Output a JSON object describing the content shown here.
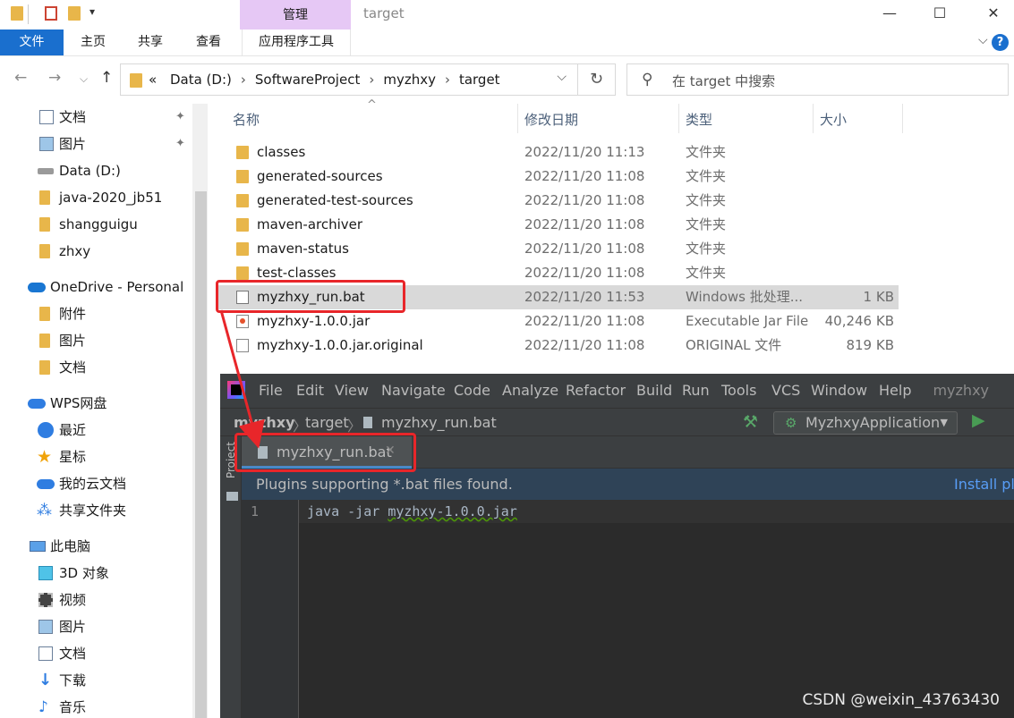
{
  "titlebar": {
    "manage_tab": "管理",
    "window_title": "target",
    "minimize": "—",
    "maximize": "☐",
    "close": "✕"
  },
  "ribbon": {
    "tabs": [
      "文件",
      "主页",
      "共享",
      "查看",
      "应用程序工具"
    ],
    "expand": "⌵",
    "help": "?"
  },
  "nav": {
    "back": "←",
    "forward": "→",
    "recent": "⌵",
    "up": "↑",
    "crumb_lead": "«",
    "crumbs": [
      "Data (D:)",
      "SoftwareProject",
      "myzhxy",
      "target"
    ],
    "search_placeholder": "在 target 中搜索"
  },
  "sidebar": {
    "items": [
      {
        "label": "文档",
        "icon": "document-icon",
        "pinned": true
      },
      {
        "label": "图片",
        "icon": "picture-icon",
        "pinned": true
      },
      {
        "label": "Data (D:)",
        "icon": "drive-icon"
      },
      {
        "label": "java-2020_jb51",
        "icon": "folder-icon"
      },
      {
        "label": "shangguigu",
        "icon": "folder-icon"
      },
      {
        "label": "zhxy",
        "icon": "folder-icon"
      },
      {
        "label": "OneDrive - Personal",
        "icon": "cloud-icon"
      },
      {
        "label": "附件",
        "icon": "folder-icon"
      },
      {
        "label": "图片",
        "icon": "folder-icon"
      },
      {
        "label": "文档",
        "icon": "folder-icon"
      },
      {
        "label": "WPS网盘",
        "icon": "cloud-icon"
      },
      {
        "label": "最近",
        "icon": "clock-icon"
      },
      {
        "label": "星标",
        "icon": "star-icon"
      },
      {
        "label": "我的云文档",
        "icon": "cloud-icon"
      },
      {
        "label": "共享文件夹",
        "icon": "share-icon"
      },
      {
        "label": "此电脑",
        "icon": "computer-icon"
      },
      {
        "label": "3D 对象",
        "icon": "cube-icon"
      },
      {
        "label": "视频",
        "icon": "video-icon"
      },
      {
        "label": "图片",
        "icon": "picture-icon"
      },
      {
        "label": "文档",
        "icon": "document-icon"
      },
      {
        "label": "下载",
        "icon": "download-icon"
      },
      {
        "label": "音乐",
        "icon": "music-icon"
      }
    ],
    "pin_glyph": "📌"
  },
  "filelist": {
    "columns": [
      "名称",
      "修改日期",
      "类型",
      "大小"
    ],
    "sort_caret": "^",
    "rows": [
      {
        "name": "classes",
        "date": "2022/11/20 11:13",
        "type": "文件夹",
        "size": "",
        "kind": "folder"
      },
      {
        "name": "generated-sources",
        "date": "2022/11/20 11:08",
        "type": "文件夹",
        "size": "",
        "kind": "folder"
      },
      {
        "name": "generated-test-sources",
        "date": "2022/11/20 11:08",
        "type": "文件夹",
        "size": "",
        "kind": "folder"
      },
      {
        "name": "maven-archiver",
        "date": "2022/11/20 11:08",
        "type": "文件夹",
        "size": "",
        "kind": "folder"
      },
      {
        "name": "maven-status",
        "date": "2022/11/20 11:08",
        "type": "文件夹",
        "size": "",
        "kind": "folder"
      },
      {
        "name": "test-classes",
        "date": "2022/11/20 11:08",
        "type": "文件夹",
        "size": "",
        "kind": "folder"
      },
      {
        "name": "myzhxy_run.bat",
        "date": "2022/11/20 11:53",
        "type": "Windows 批处理...",
        "size": "1 KB",
        "kind": "bat",
        "selected": true
      },
      {
        "name": "myzhxy-1.0.0.jar",
        "date": "2022/11/20 11:08",
        "type": "Executable Jar File",
        "size": "40,246 KB",
        "kind": "jar"
      },
      {
        "name": "myzhxy-1.0.0.jar.original",
        "date": "2022/11/20 11:08",
        "type": "ORIGINAL 文件",
        "size": "819 KB",
        "kind": "file"
      }
    ]
  },
  "ide": {
    "menu": [
      "File",
      "Edit",
      "View",
      "Navigate",
      "Code",
      "Analyze",
      "Refactor",
      "Build",
      "Run",
      "Tools",
      "VCS",
      "Window",
      "Help"
    ],
    "project_name": "myzhxy",
    "nav_crumbs": [
      "myzhxy",
      "target",
      "myzhxy_run.bat"
    ],
    "run_config": "MyzhxyApplication",
    "side_tab": "Project",
    "tab_label": "myzhxy_run.bat",
    "tab_close": "✕",
    "banner_message": "Plugins supporting *.bat files found.",
    "banner_action": "Install plu",
    "line_number": "1",
    "code_prefix": "java -jar ",
    "code_jar": "myzhxy-1.0.0.jar"
  },
  "watermark": "CSDN @weixin_43763430",
  "colors": {
    "accent": "#1a6fce",
    "highlight": "#e8262a",
    "ide_bg": "#2b2b2b",
    "manage_tab": "#e6c8f5"
  }
}
